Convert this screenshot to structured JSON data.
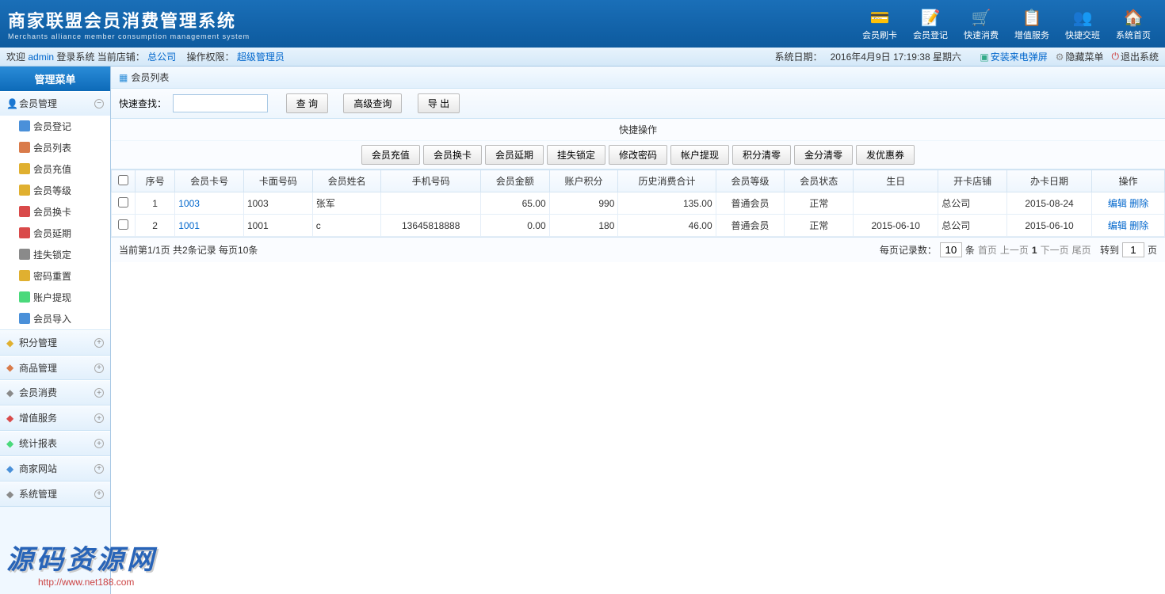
{
  "header": {
    "title": "商家联盟会员消费管理系统",
    "subtitle": "Merchants alliance member consumption management system",
    "nav": [
      {
        "label": "会员刷卡",
        "icon": "💳"
      },
      {
        "label": "会员登记",
        "icon": "📝"
      },
      {
        "label": "快速消费",
        "icon": "🛒"
      },
      {
        "label": "增值服务",
        "icon": "📋"
      },
      {
        "label": "快捷交班",
        "icon": "👥"
      },
      {
        "label": "系统首页",
        "icon": "🏠"
      }
    ]
  },
  "statusbar": {
    "welcome_prefix": "欢迎",
    "user": "admin",
    "login_sys": "登录系统",
    "store_label": "当前店铺：",
    "store": "总公司",
    "perm_label": "操作权限：",
    "role": "超级管理员",
    "date_label": "系统日期：",
    "date_value": "2016年4月9日 17:19:38 星期六",
    "install": "安装来电弹屏",
    "hide_menu": "隐藏菜单",
    "logout": "退出系统"
  },
  "sidebar": {
    "title": "管理菜单",
    "active_group": "会员管理",
    "items": [
      {
        "label": "会员登记",
        "color": "#4a90d9"
      },
      {
        "label": "会员列表",
        "color": "#d97b4a"
      },
      {
        "label": "会员充值",
        "color": "#e0b030"
      },
      {
        "label": "会员等级",
        "color": "#e0b030"
      },
      {
        "label": "会员换卡",
        "color": "#d94a4a"
      },
      {
        "label": "会员延期",
        "color": "#d94a4a"
      },
      {
        "label": "挂失锁定",
        "color": "#8a8a8a"
      },
      {
        "label": "密码重置",
        "color": "#e0b030"
      },
      {
        "label": "账户提现",
        "color": "#4ad97b"
      },
      {
        "label": "会员导入",
        "color": "#4a90d9"
      }
    ],
    "groups": [
      {
        "label": "积分管理",
        "color": "#e0b030"
      },
      {
        "label": "商品管理",
        "color": "#d97b4a"
      },
      {
        "label": "会员消费",
        "color": "#8a8a8a"
      },
      {
        "label": "增值服务",
        "color": "#d94a4a"
      },
      {
        "label": "统计报表",
        "color": "#4ad97b"
      },
      {
        "label": "商家网站",
        "color": "#4a90d9"
      },
      {
        "label": "系统管理",
        "color": "#8a8a8a"
      }
    ]
  },
  "panel": {
    "title": "会员列表",
    "search_label": "快速查找：",
    "btn_query": "查 询",
    "btn_adv": "高级查询",
    "btn_export": "导 出"
  },
  "quickops": {
    "title": "快捷操作",
    "btns": [
      "会员充值",
      "会员换卡",
      "会员延期",
      "挂失锁定",
      "修改密码",
      "帐户提现",
      "积分清零",
      "金分清零",
      "发优惠券"
    ]
  },
  "table": {
    "headers": [
      "",
      "序号",
      "会员卡号",
      "卡面号码",
      "会员姓名",
      "手机号码",
      "会员金额",
      "账户积分",
      "历史消费合计",
      "会员等级",
      "会员状态",
      "生日",
      "开卡店铺",
      "办卡日期",
      "操作"
    ],
    "rows": [
      {
        "seq": "1",
        "card": "1003",
        "face": "1003",
        "name": "张军",
        "phone": "",
        "amount": "65.00",
        "points": "990",
        "total": "135.00",
        "level": "普通会员",
        "status": "正常",
        "birth": "",
        "store": "总公司",
        "date": "2015-08-24"
      },
      {
        "seq": "2",
        "card": "1001",
        "face": "1001",
        "name": "c",
        "phone": "13645818888",
        "amount": "0.00",
        "points": "180",
        "total": "46.00",
        "level": "普通会员",
        "status": "正常",
        "birth": "2015-06-10",
        "store": "总公司",
        "date": "2015-06-10"
      }
    ],
    "op_edit": "编辑",
    "op_del": "删除"
  },
  "pager": {
    "summary": "当前第1/1页 共2条记录 每页10条",
    "per_page_label": "每页记录数：",
    "per_page": "10",
    "first": "首页",
    "prev": "上一页",
    "cur": "1",
    "next": "下一页",
    "last": "尾页",
    "goto_label": "转到",
    "goto_val": "1",
    "unit": "页"
  },
  "watermark": {
    "text": "源码资源网",
    "url": "http://www.net188.com"
  }
}
